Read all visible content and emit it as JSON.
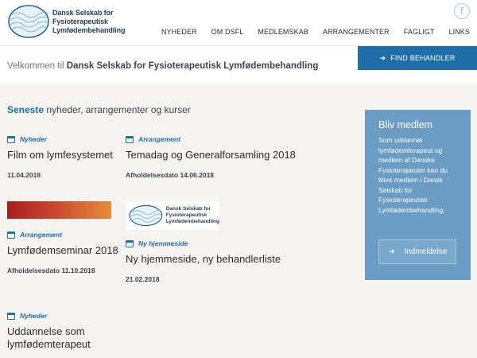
{
  "site": {
    "logo_text_lines": [
      "Dansk Selskab for",
      "Fysioterapeutisk",
      "Lymfødembehandling"
    ],
    "facebook_glyph": "f"
  },
  "nav": [
    "NYHEDER",
    "OM DSFL",
    "MEDLEMSKAB",
    "ARRANGEMENTER",
    "FAGLIGT",
    "LINKS"
  ],
  "welcome": {
    "prefix": "Velkommen til",
    "name": "Dansk Selskab for Fysioterapeutisk Lymfødembehandling"
  },
  "find_button": {
    "arrow": "➜",
    "label": "FIND BEHANDLER"
  },
  "section": {
    "highlight": "Seneste",
    "rest": "nyheder, arrangementer og kurser"
  },
  "cards": [
    {
      "category": "Nyheder",
      "title": "Film om lymfesystemet",
      "date": "11.04.2018"
    },
    {
      "category": "Arrangement",
      "title": "Temadag og Generalforsamling 2018",
      "date": "Afholdelsesdato 14.06.2018"
    },
    {
      "category": "Arrangement",
      "title": "Lymfødemseminar 2018",
      "date": "Afholdelsesdato 11.10.2018"
    },
    {
      "category": "Ny hjemmeside",
      "title": "Ny hjemmeside, ny behandlerliste",
      "date": "21.02.2018"
    },
    {
      "category": "Nyheder",
      "title": "Uddannelse som lymfødemterapeut",
      "date": ""
    }
  ],
  "logo_thumb_lines": [
    "Dansk Selskab for",
    "Fysioterapeutisk",
    "Lymfødembehandling"
  ],
  "bliv": {
    "title": "Bliv medlem",
    "text": "Som uddannet lymfødemterapeut og medlem af Danske Fysioterapeuter kan du blive medlem i Dansk Selskab for Fysioterapeutisk Lymfødembehandling.",
    "button_arrow": "➜",
    "button_label": "Indmeldelse"
  },
  "colors": {
    "brand_blue": "#1f6ea8",
    "sidebar_blue": "#6a9cc4",
    "background": "#f4f3f0"
  }
}
